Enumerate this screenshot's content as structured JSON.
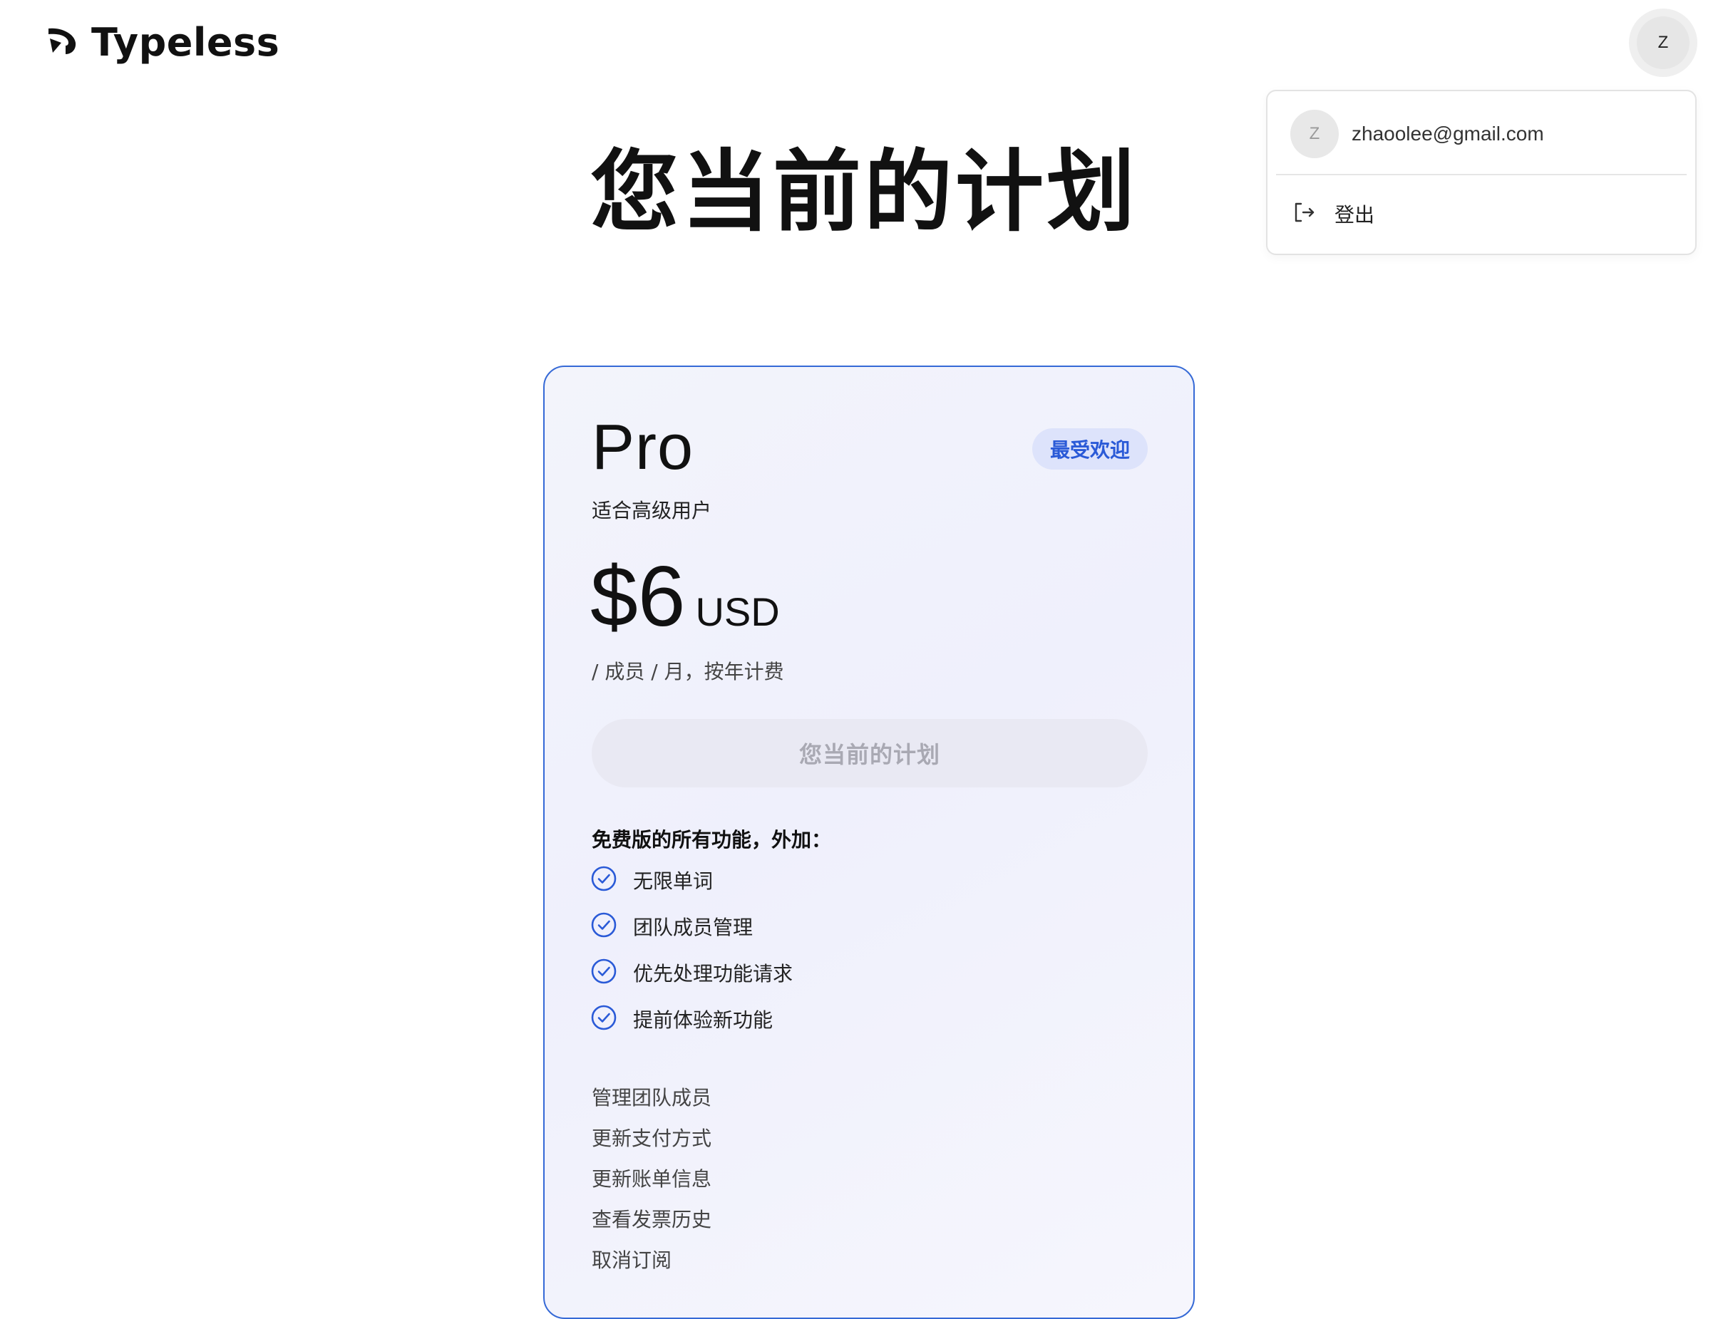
{
  "header": {
    "brand": "Typeless",
    "logo_icon": "typeless-logo-icon",
    "avatar_initial": "Z"
  },
  "account_menu": {
    "avatar_initial": "Z",
    "email": "zhaoolee@gmail.com",
    "logout_icon": "logout-icon",
    "logout_label": "登出"
  },
  "page": {
    "title": "您当前的计划"
  },
  "plan": {
    "name": "Pro",
    "badge": "最受欢迎",
    "subtitle": "适合高级用户",
    "price": "$6",
    "currency": "USD",
    "period": "/ 成员 / 月，按年计费",
    "current_button": "您当前的计划",
    "features_heading": "免费版的所有功能，外加：",
    "features": [
      {
        "icon": "check-circle-icon",
        "label": "无限单词"
      },
      {
        "icon": "check-circle-icon",
        "label": "团队成员管理"
      },
      {
        "icon": "check-circle-icon",
        "label": "优先处理功能请求"
      },
      {
        "icon": "check-circle-icon",
        "label": "提前体验新功能"
      }
    ],
    "links": [
      "管理团队成员",
      "更新支付方式",
      "更新账单信息",
      "查看发票历史",
      "取消订阅"
    ]
  },
  "colors": {
    "accent": "#2a5ad7",
    "card_border": "#3569d6",
    "badge_bg": "#dde3fb",
    "disabled_button_bg": "#e9e9f3",
    "disabled_button_text": "#a9a9b3"
  }
}
